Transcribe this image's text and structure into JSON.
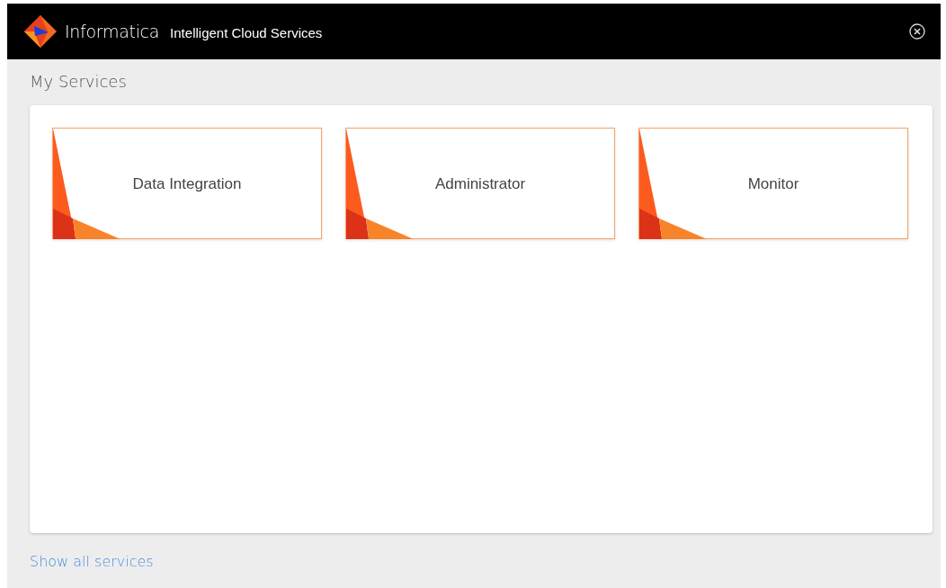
{
  "header": {
    "brand": "Informatica",
    "product": "Intelligent Cloud Services"
  },
  "section_title": "My Services",
  "services": [
    {
      "name": "Data Integration"
    },
    {
      "name": "Administrator"
    },
    {
      "name": "Monitor"
    }
  ],
  "footer_link": "Show all services"
}
